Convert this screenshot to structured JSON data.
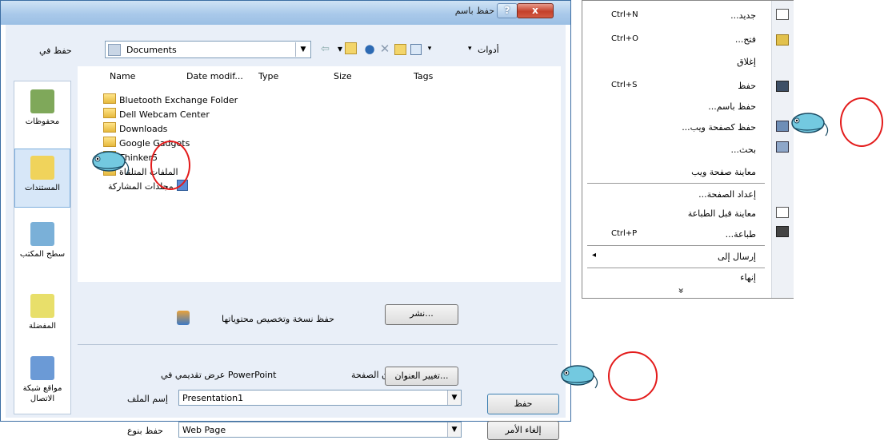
{
  "dialog": {
    "title": "حفظ باسم",
    "help_glyph": "?",
    "close_glyph": "x",
    "save_in_label": "حفظ في",
    "location": "Documents",
    "tools_label": "أدوات"
  },
  "places": [
    {
      "label": "محفوظات",
      "icon": "history-icon",
      "color": "#7fa85a"
    },
    {
      "label": "المستندات",
      "icon": "documents-folder-icon",
      "color": "#f0d35b"
    },
    {
      "label": "سطح المكتب",
      "icon": "desktop-icon",
      "color": "#7ab0d8"
    },
    {
      "label": "المفضلة",
      "icon": "favorites-icon",
      "color": "#e8df6a"
    },
    {
      "label": "مواقع شبكة الاتصال",
      "icon": "network-places-icon",
      "color": "#6b9ad6"
    }
  ],
  "columns": [
    "Name",
    "Date modif...",
    "Type",
    "Size",
    "Tags"
  ],
  "files": [
    "Bluetooth Exchange Folder",
    "Dell Webcam Center",
    "Downloads",
    "Google Gadgets",
    "Thinker5",
    "الملفات المتلقاة",
    "مجلدات المشاركة"
  ],
  "publish": {
    "description": "حفظ نسخة وتخصيص محتوياتها",
    "button": "نشر..."
  },
  "page_title": {
    "label": "عنوان الصفحة:",
    "value": "عرض تقديمي في PowerPoint",
    "button": "تغيير العنوان..."
  },
  "filename": {
    "label": "إسم الملف",
    "value": "Presentation1"
  },
  "filetype": {
    "label": "حفظ بنوع",
    "value": "Web Page"
  },
  "buttons": {
    "save": "حفظ",
    "cancel": "إلغاء الأمر"
  },
  "menu": {
    "items": [
      {
        "label": "جديد...",
        "shortcut": "Ctrl+N"
      },
      {
        "label": "فتح...",
        "shortcut": "Ctrl+O"
      },
      {
        "label": "إغلاق",
        "shortcut": ""
      },
      {
        "label": "حفظ",
        "shortcut": "Ctrl+S"
      },
      {
        "label": "حفظ باسم...",
        "shortcut": ""
      },
      {
        "label": "حفظ كصفحة ويب...",
        "shortcut": ""
      },
      {
        "label": "بحث...",
        "shortcut": ""
      },
      {
        "label": "معاينة صفحة ويب",
        "shortcut": ""
      },
      {
        "label": "إعداد الصفحة...",
        "shortcut": ""
      },
      {
        "label": "معاينة قبل الطباعة",
        "shortcut": ""
      },
      {
        "label": "طباعة...",
        "shortcut": "Ctrl+P"
      },
      {
        "label": "إرسال إلى",
        "shortcut": ""
      },
      {
        "label": "إنهاء",
        "shortcut": ""
      }
    ],
    "expand_glyph": "»",
    "submenu_glyph": "◂"
  }
}
